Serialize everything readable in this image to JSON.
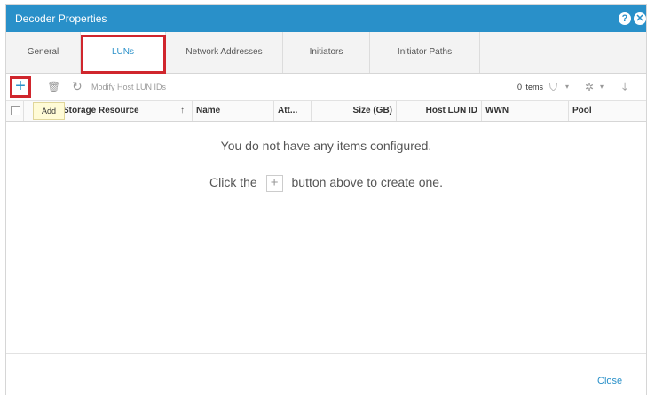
{
  "window": {
    "title": "Decoder Properties",
    "help_icon": "?",
    "close_icon": "✕"
  },
  "tabs": [
    {
      "label": "General"
    },
    {
      "label": "LUNs",
      "active": true
    },
    {
      "label": "Network Addresses"
    },
    {
      "label": "Initiators"
    },
    {
      "label": "Initiator Paths"
    }
  ],
  "toolbar": {
    "add_glyph": "+",
    "delete_glyph": "🗑",
    "refresh_glyph": "↻",
    "modify_label": "Modify Host LUN IDs",
    "items_count": "0 items",
    "filter_glyph": "⛉",
    "settings_glyph": "✲",
    "export_glyph": "⤓",
    "caret": "▾"
  },
  "tooltip": {
    "text": "Add"
  },
  "table": {
    "columns": [
      "Storage Resource",
      "Name",
      "Att...",
      "Size (GB)",
      "Host LUN ID",
      "WWN",
      "Pool"
    ],
    "sort_glyph": "↑"
  },
  "empty_state": {
    "line1": "You do not have any items configured.",
    "line2_prefix": "Click the",
    "line2_glyph": "+",
    "line2_suffix": "button above to create one."
  },
  "footer": {
    "close_label": "Close"
  },
  "colors": {
    "accent": "#2990c9",
    "highlight": "#d0262d",
    "tooltip_bg": "#fffbd6"
  }
}
